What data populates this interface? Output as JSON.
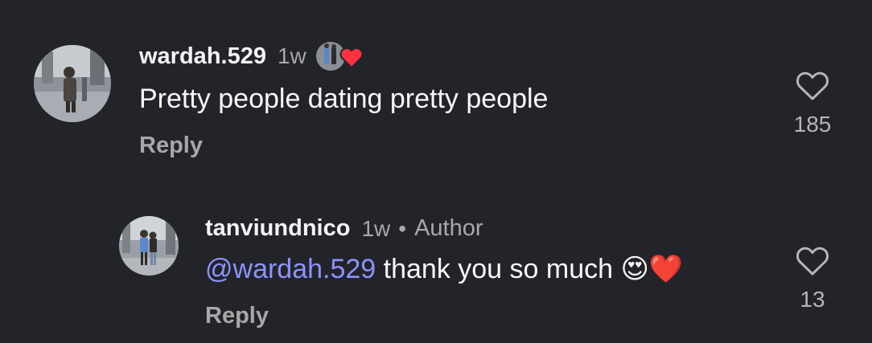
{
  "comments": [
    {
      "username": "wardah.529",
      "time": "1w",
      "text": "Pretty people dating pretty people",
      "reply_label": "Reply",
      "like_count": "185",
      "liked_by_author": true,
      "avatar_icon": "user-photo-avatar"
    },
    {
      "username": "tanviundnico",
      "time": "1w",
      "dot": "•",
      "author_label": "Author",
      "mention": "@wardah.529",
      "text": " thank you so much ",
      "emojis": "😍❤️",
      "reply_label": "Reply",
      "like_count": "13",
      "avatar_icon": "author-photo-avatar"
    }
  ],
  "colors": {
    "background": "#232429",
    "mention": "#8c93ff",
    "heart_badge": "#ff3040",
    "secondary_text": "#a8a8a8"
  }
}
